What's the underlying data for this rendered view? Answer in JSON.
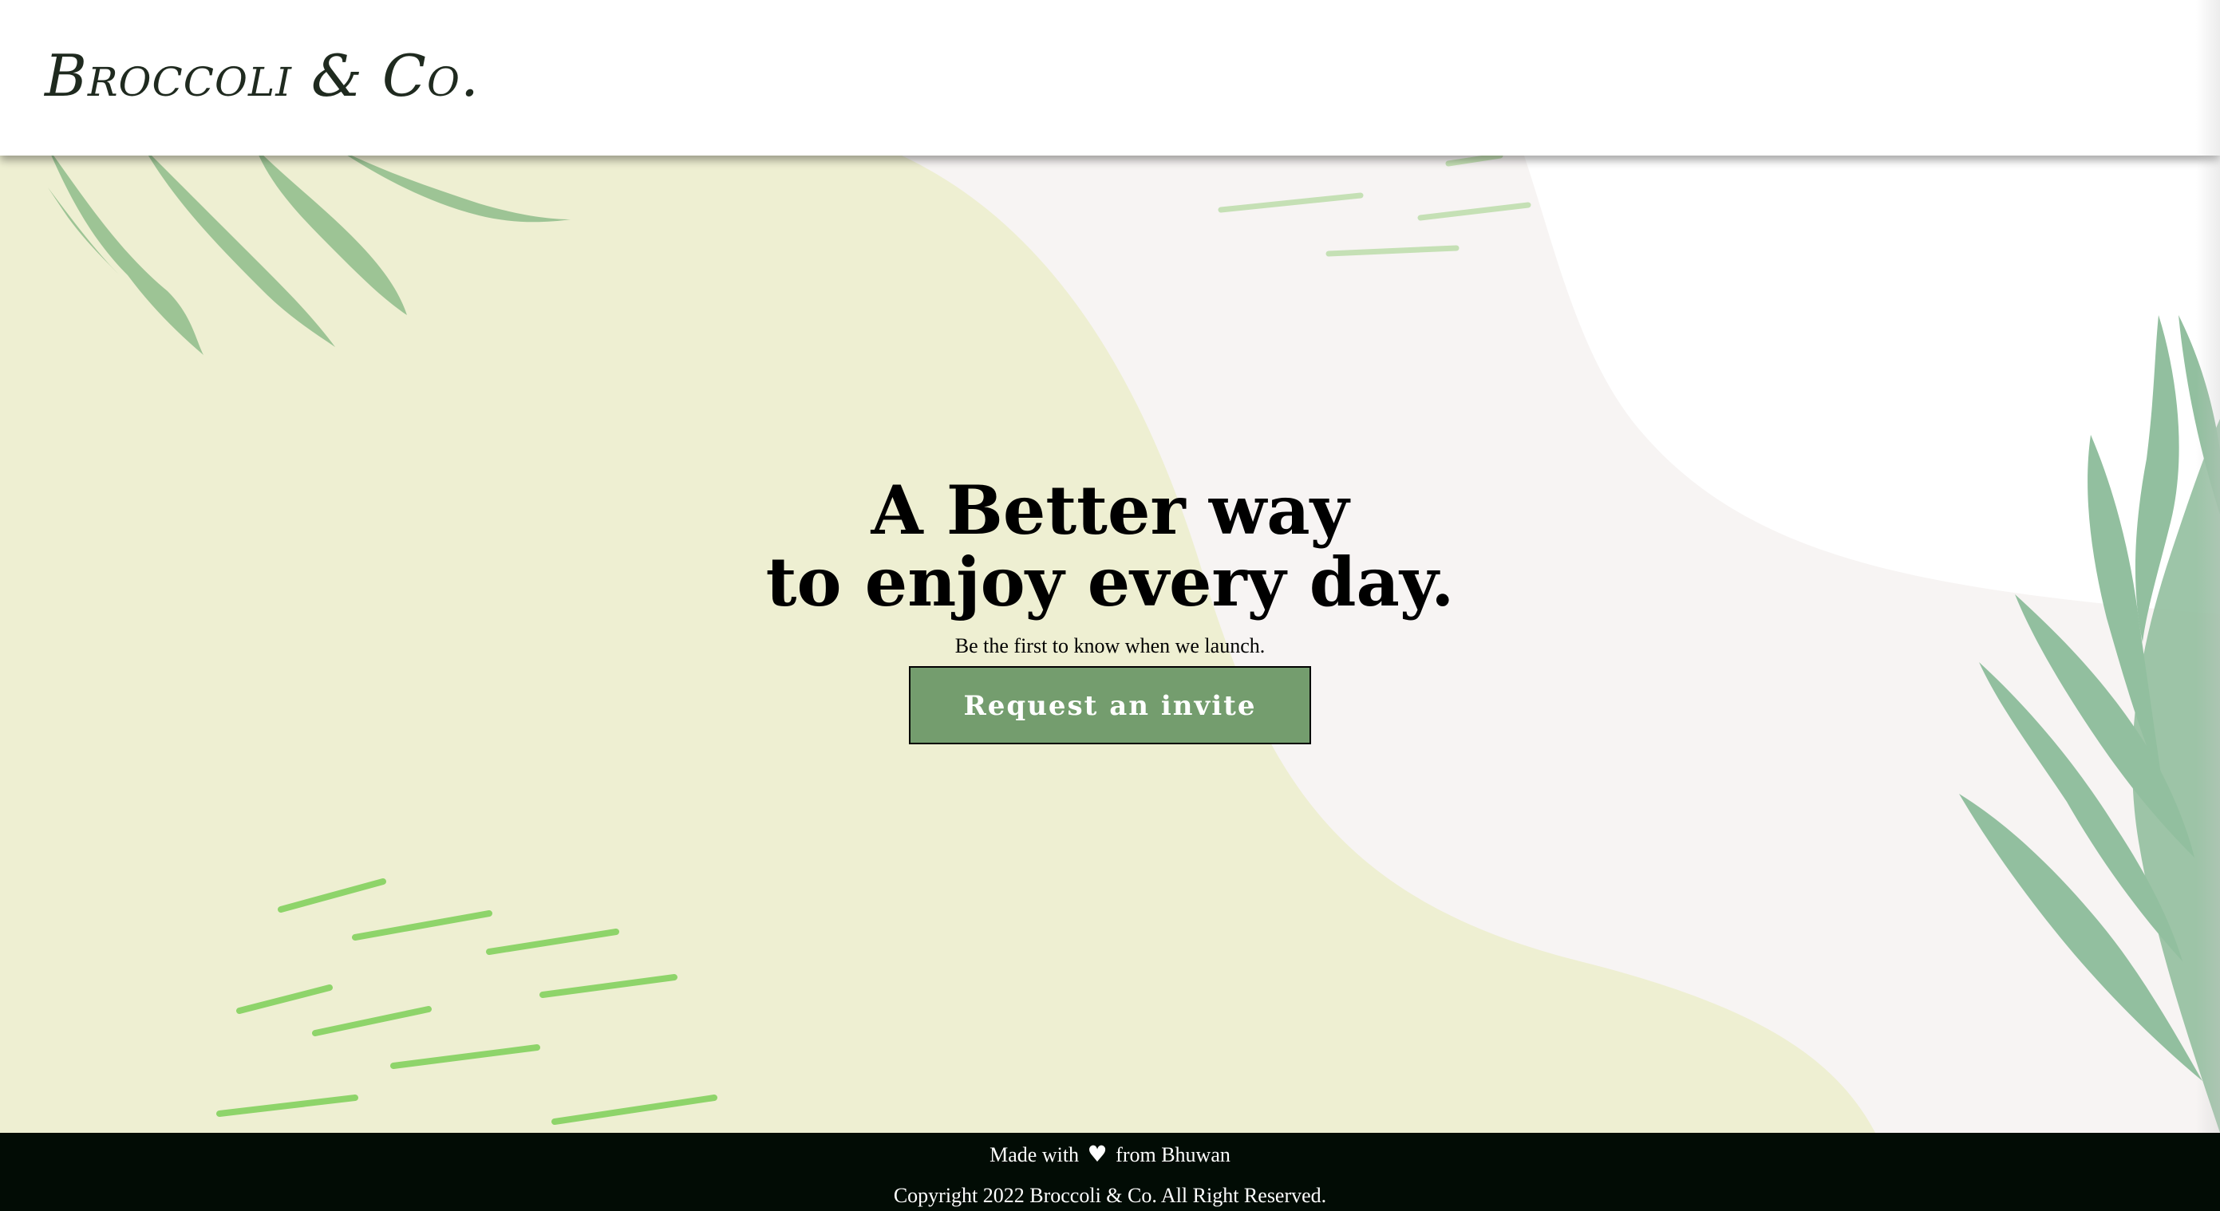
{
  "header": {
    "logo": "Broccoli & Co."
  },
  "hero": {
    "headline_line1": "A Better way",
    "headline_line2": "to enjoy every day.",
    "subtitle": "Be the first to know when we launch.",
    "cta_label": "Request an invite"
  },
  "footer": {
    "made_with_prefix": "Made with",
    "heart_icon": "heart-icon",
    "made_with_suffix": "from Bhuwan",
    "copyright": "Copyright 2022 Broccoli & Co. All Right Reserved."
  },
  "colors": {
    "accent_green": "#749d6e",
    "blob_light": "#eeefd2",
    "blob_pale": "#f7f4f3",
    "leaf_green": "#8fbf94",
    "grass_green": "#8ed46a",
    "footer_bg": "#020c05"
  }
}
